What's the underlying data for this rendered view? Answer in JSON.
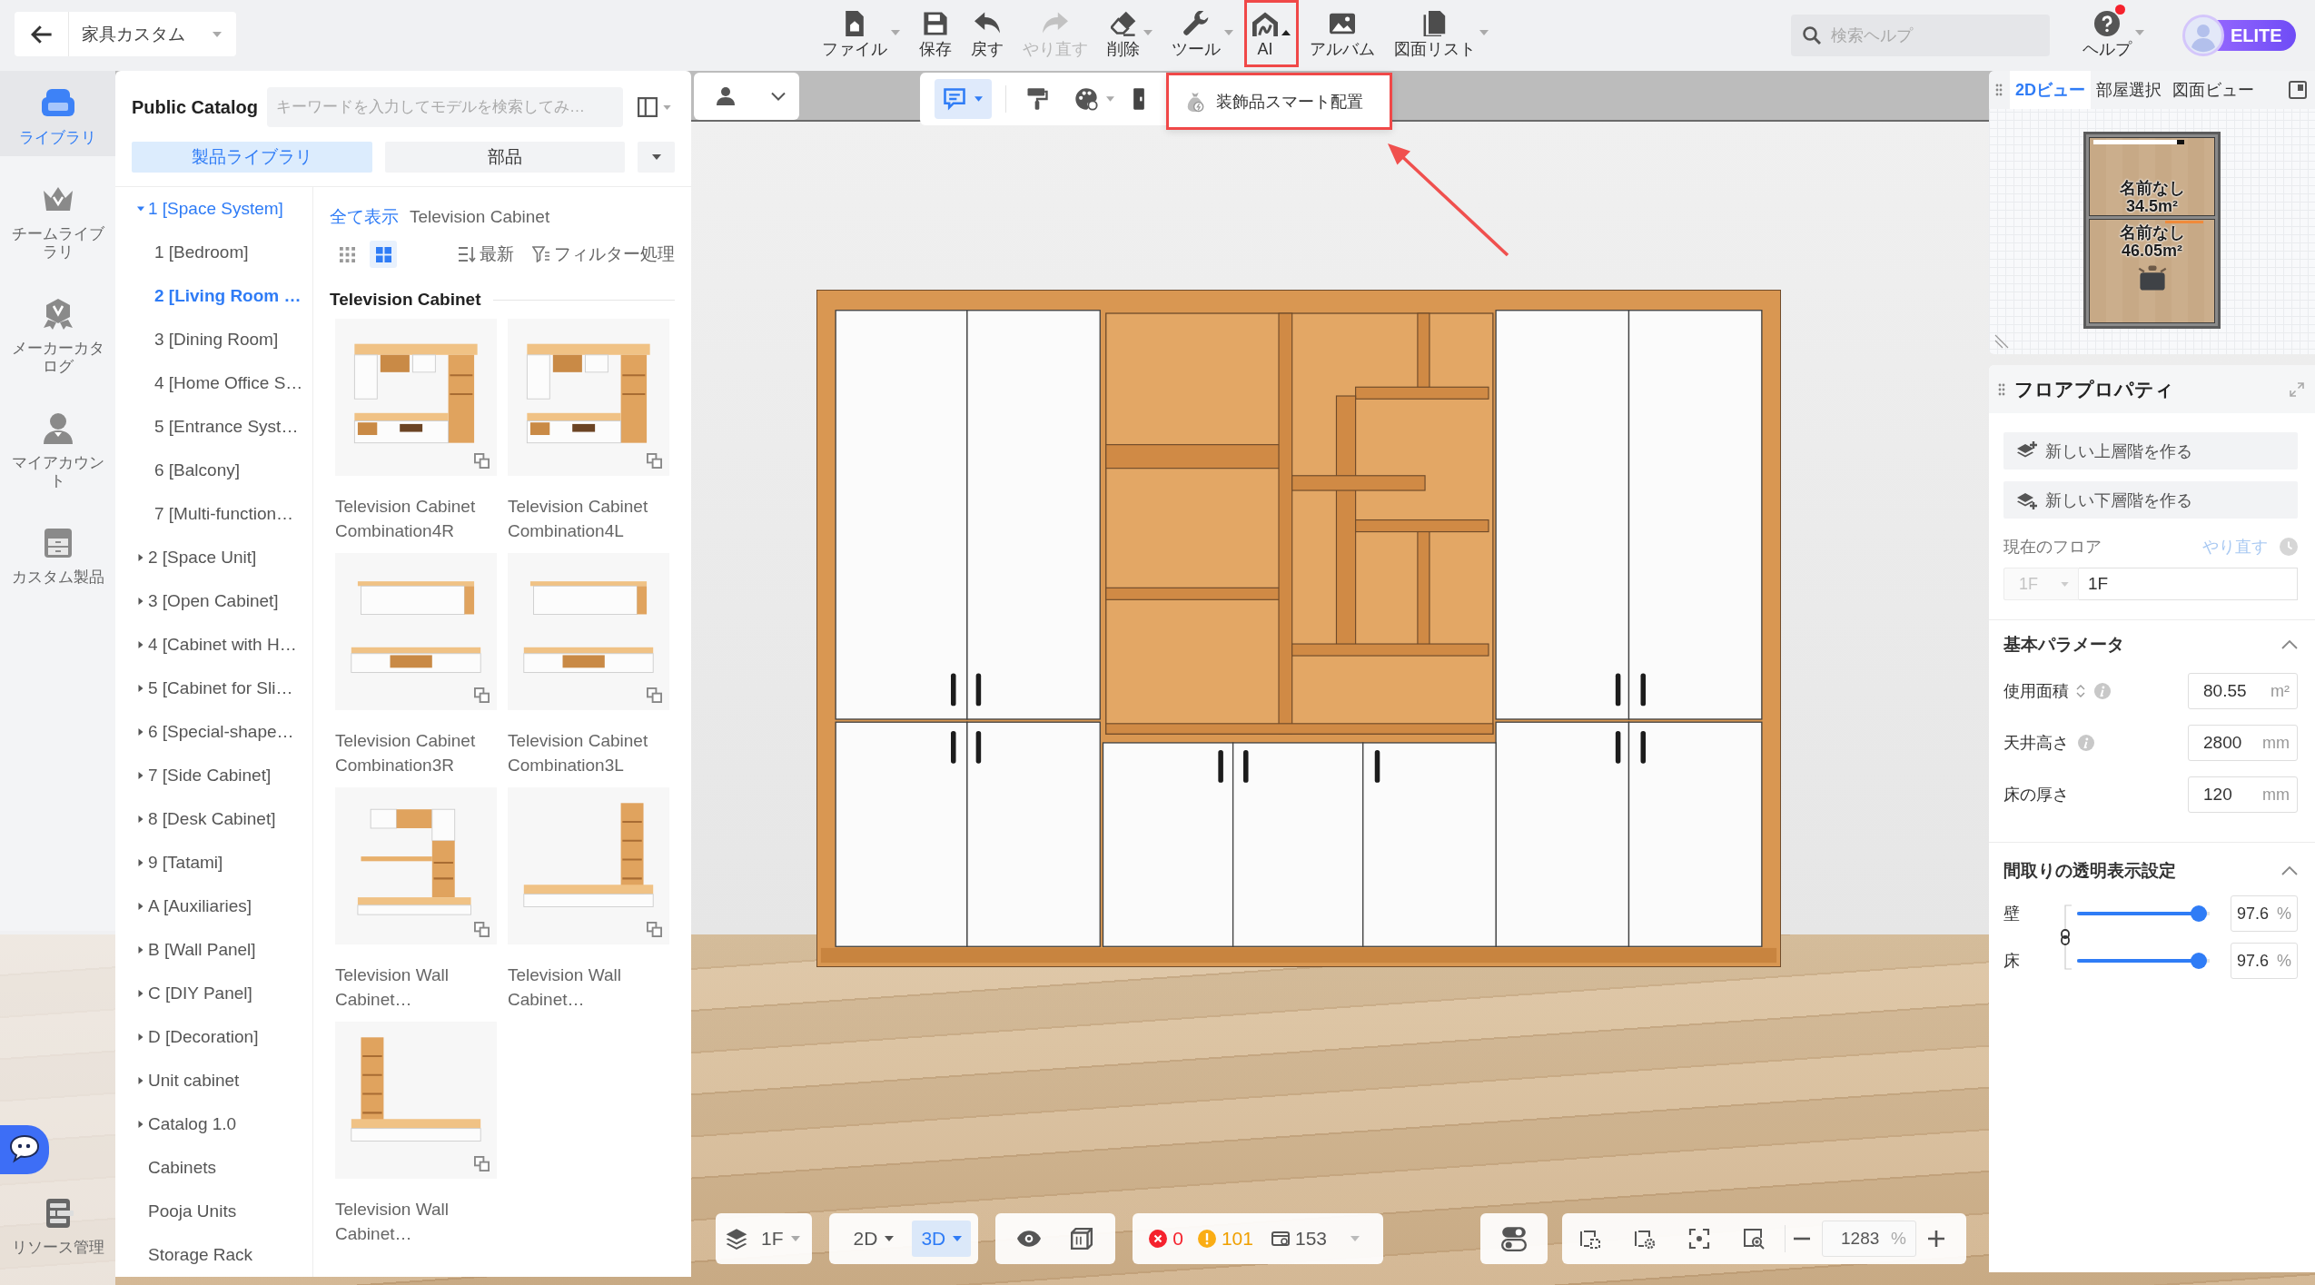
{
  "topbar": {
    "project": "家具カスタム",
    "tools": [
      {
        "kind": "file",
        "label": "ファイル",
        "dropdown": true,
        "disabled": false,
        "highlighted": false
      },
      {
        "kind": "save",
        "label": "保存",
        "dropdown": false,
        "disabled": false,
        "highlighted": false
      },
      {
        "kind": "undo",
        "label": "戻す",
        "dropdown": false,
        "disabled": false,
        "highlighted": false
      },
      {
        "kind": "redo",
        "label": "やり直す",
        "dropdown": false,
        "disabled": true,
        "highlighted": false
      },
      {
        "kind": "erase",
        "label": "削除",
        "dropdown": true,
        "disabled": false,
        "highlighted": false
      },
      {
        "kind": "tools",
        "label": "ツール",
        "dropdown": true,
        "disabled": false,
        "highlighted": false
      },
      {
        "kind": "ai",
        "label": "AI",
        "dropdown": true,
        "disabled": false,
        "highlighted": true
      },
      {
        "kind": "album",
        "label": "アルバム",
        "dropdown": false,
        "disabled": false,
        "highlighted": false
      },
      {
        "kind": "drawings",
        "label": "図面リスト",
        "dropdown": true,
        "disabled": false,
        "highlighted": false
      }
    ],
    "search": {
      "placeholder": "検索ヘルプ"
    },
    "help": {
      "label": "ヘルプ",
      "notification": true
    },
    "plan_badge": "ELITE"
  },
  "ai_menu": {
    "items": [
      {
        "label": "装飾品スマート配置",
        "highlighted": true
      }
    ],
    "pointer_arrow": true
  },
  "sidebar": {
    "items": [
      {
        "kind": "sofa",
        "label": "ライブラリ",
        "selected": true
      },
      {
        "kind": "crown",
        "label": "チームライブラリ",
        "selected": false
      },
      {
        "kind": "badge",
        "label": "メーカーカタログ",
        "selected": false
      },
      {
        "kind": "person",
        "label": "マイアカウント",
        "selected": false
      },
      {
        "kind": "drawer",
        "label": "カスタム製品",
        "selected": false
      }
    ],
    "bottom_item": {
      "label": "リソース管理"
    }
  },
  "catalog": {
    "title": "Public Catalog",
    "search": {
      "placeholder": "キーワードを入力してモデルを検索してみ…"
    },
    "tabs": [
      {
        "label": "製品ライブラリ",
        "selected": true
      },
      {
        "label": "部品",
        "selected": false
      }
    ],
    "tree": [
      {
        "label": "1 [Space System]",
        "kind": "group",
        "expanded": true,
        "selected": false,
        "children": [
          {
            "label": "1 [Bedroom]",
            "kind": "leaf",
            "selected": false
          },
          {
            "label": "2 [Living Room …",
            "kind": "leaf",
            "selected": true
          },
          {
            "label": "3 [Dining Room]",
            "kind": "leaf",
            "selected": false
          },
          {
            "label": "4 [Home Office S…",
            "kind": "leaf",
            "selected": false
          },
          {
            "label": "5 [Entrance Syst…",
            "kind": "leaf",
            "selected": false
          },
          {
            "label": "6 [Balcony]",
            "kind": "leaf",
            "selected": false
          },
          {
            "label": "7 [Multi-function…",
            "kind": "leaf",
            "selected": false
          }
        ]
      },
      {
        "label": "2 [Space Unit]",
        "kind": "group",
        "expanded": false,
        "selected": false
      },
      {
        "label": "3 [Open Cabinet]",
        "kind": "group",
        "expanded": false,
        "selected": false
      },
      {
        "label": "4 [Cabinet with H…",
        "kind": "group",
        "expanded": false,
        "selected": false
      },
      {
        "label": "5 [Cabinet for Sli…",
        "kind": "group",
        "expanded": false,
        "selected": false
      },
      {
        "label": "6 [Special-shape…",
        "kind": "group",
        "expanded": false,
        "selected": false
      },
      {
        "label": "7 [Side Cabinet]",
        "kind": "group",
        "expanded": false,
        "selected": false
      },
      {
        "label": "8 [Desk Cabinet]",
        "kind": "group",
        "expanded": false,
        "selected": false
      },
      {
        "label": "9 [Tatami]",
        "kind": "group",
        "expanded": false,
        "selected": false
      },
      {
        "label": "A [Auxiliaries]",
        "kind": "group",
        "expanded": false,
        "selected": false
      },
      {
        "label": "B [Wall Panel]",
        "kind": "group",
        "expanded": false,
        "selected": false
      },
      {
        "label": "C [DIY Panel]",
        "kind": "group",
        "expanded": false,
        "selected": false
      },
      {
        "label": "D [Decoration]",
        "kind": "group",
        "expanded": false,
        "selected": false
      },
      {
        "label": "Unit cabinet",
        "kind": "group",
        "expanded": false,
        "selected": false
      },
      {
        "label": "Catalog 1.0",
        "kind": "group",
        "expanded": false,
        "selected": false
      },
      {
        "label": "Cabinets",
        "kind": "leaf",
        "selected": false
      },
      {
        "label": "Pooja Units",
        "kind": "leaf",
        "selected": false
      },
      {
        "label": "Storage Rack",
        "kind": "leaf",
        "selected": false
      }
    ],
    "breadcrumb": {
      "link": "全て表示",
      "current": "Television Cabinet"
    },
    "view_toggles": [
      {
        "kind": "small",
        "selected": false
      },
      {
        "kind": "large",
        "selected": true
      }
    ],
    "sort": "最新",
    "filter": "フィルター処理",
    "section": "Television Cabinet",
    "products": [
      {
        "name": "Television Cabinet Combination4R",
        "kind": "frame"
      },
      {
        "name": "Television Cabinet Combination4L",
        "kind": "frame"
      },
      {
        "name": "Television Cabinet Combination3R",
        "kind": "split"
      },
      {
        "name": "Television Cabinet Combination3L",
        "kind": "split"
      },
      {
        "name": "Television Wall Cabinet…",
        "kind": "desk"
      },
      {
        "name": "Television Wall Cabinet…",
        "kind": "tower-right"
      },
      {
        "name": "Television Wall Cabinet…",
        "kind": "tower-left"
      }
    ]
  },
  "scene_toolbar": [
    {
      "kind": "comment",
      "selected": true,
      "dropdown": true
    },
    {
      "kind": "roller",
      "selected": false,
      "dropdown": false
    },
    {
      "kind": "palette",
      "selected": false,
      "dropdown": true
    },
    {
      "kind": "door",
      "selected": false,
      "dropdown": false
    }
  ],
  "bottom_bar": {
    "floor": "1F",
    "view_modes": [
      {
        "label": "2D",
        "selected": false
      },
      {
        "label": "3D",
        "selected": true
      }
    ],
    "counts": [
      {
        "kind": "error",
        "value": "0"
      },
      {
        "kind": "warning",
        "value": "101"
      },
      {
        "kind": "objects",
        "value": "153"
      }
    ],
    "zoom": {
      "value": "1283",
      "unit": "%"
    }
  },
  "minimap": {
    "tabs": [
      {
        "label": "2Dビュー",
        "selected": true
      },
      {
        "label": "部屋選択",
        "selected": false
      },
      {
        "label": "図面ビュー",
        "selected": false
      }
    ],
    "rooms": [
      {
        "name": "名前なし",
        "area": "34.5m²"
      },
      {
        "name": "名前なし",
        "area": "46.05m²"
      }
    ]
  },
  "floor_properties": {
    "title": "フロアプロパティ",
    "actions": [
      {
        "kind": "up",
        "label": "新しい上層階を作る"
      },
      {
        "kind": "down",
        "label": "新しい下層階を作る"
      }
    ],
    "current_floor": {
      "label": "現在のフロア",
      "redo": {
        "label": "やり直す",
        "disabled": true
      },
      "select": {
        "value": "1F",
        "disabled": true
      },
      "name": "1F"
    },
    "basic": {
      "title": "基本パラメータ",
      "expanded": true,
      "fields": [
        {
          "label": "使用面積",
          "value": "80.55",
          "unit": "m²",
          "unit_toggle": true,
          "info": true
        },
        {
          "label": "天井高さ",
          "value": "2800",
          "unit": "mm",
          "unit_toggle": false,
          "info": true
        },
        {
          "label": "床の厚さ",
          "value": "120",
          "unit": "mm",
          "unit_toggle": false,
          "info": false
        }
      ]
    },
    "transparency": {
      "title": "間取りの透明表示設定",
      "expanded": true,
      "linked": true,
      "sliders": [
        {
          "label": "壁",
          "level": 0.976,
          "value": "97.6",
          "unit": "%"
        },
        {
          "label": "床",
          "level": 0.976,
          "value": "97.6",
          "unit": "%"
        }
      ]
    }
  }
}
